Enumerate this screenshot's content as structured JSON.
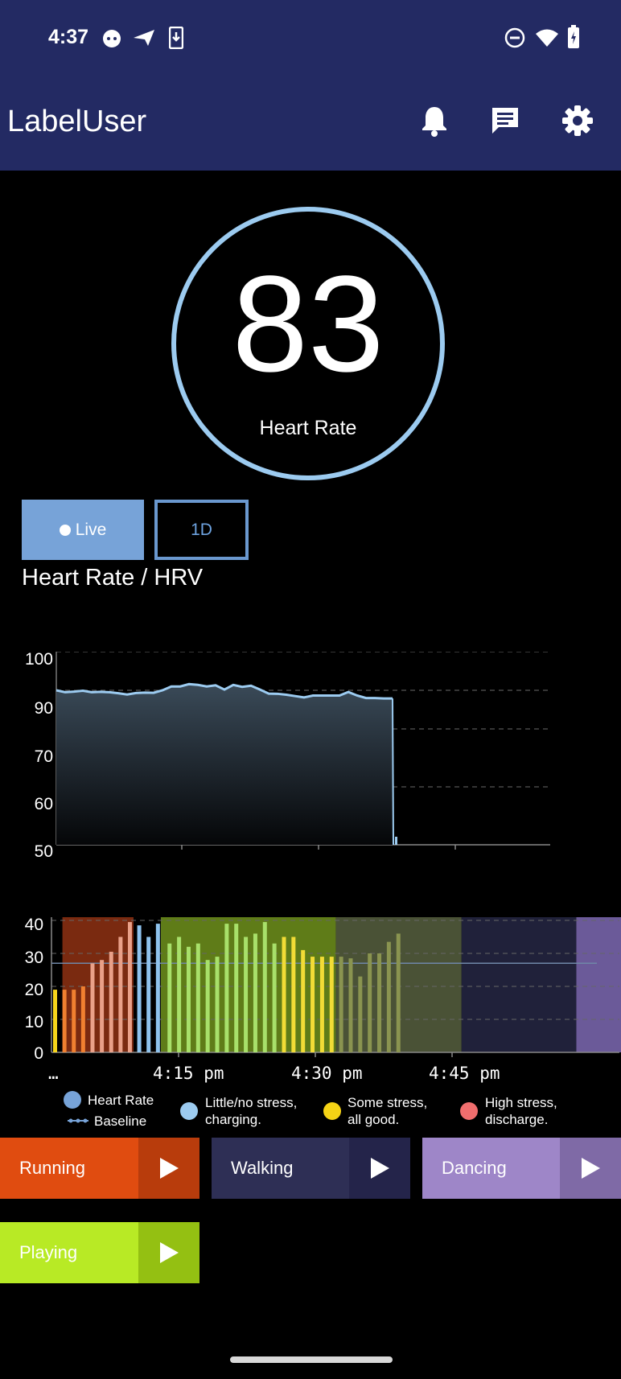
{
  "status_bar": {
    "time": "4:37",
    "left_icons": [
      "cat-face-icon",
      "send-icon",
      "download-icon"
    ],
    "right_icons": [
      "do-not-disturb-icon",
      "wifi-icon",
      "battery-charging-icon"
    ]
  },
  "app_bar": {
    "title": "LabelUser",
    "actions": [
      "bell-icon",
      "message-icon",
      "gear-icon"
    ]
  },
  "heart_rate_gauge": {
    "value": "83",
    "label": "Heart Rate",
    "ring_color": "#9ccbf0"
  },
  "tabs": {
    "live_label": "Live",
    "day_label": "1D",
    "selected": "Live"
  },
  "chart_title": "Heart Rate / HRV",
  "chart_data": [
    {
      "type": "area",
      "title": "",
      "y_ticks": [
        "100",
        "90",
        "70",
        "60",
        "50"
      ],
      "ylim": [
        50,
        100
      ],
      "grid": "dashed horizontal",
      "values": [
        90,
        89,
        89.3,
        89.8,
        89,
        89.2,
        89,
        88.5,
        87.8,
        88.6,
        88.8,
        88.7,
        90,
        91,
        91,
        91.6,
        91.4,
        91,
        91.3,
        90.2,
        91.4,
        90.9,
        91.2,
        90.2,
        88.3,
        88.2,
        87.7,
        87,
        86.3,
        87.3,
        87.3,
        87.3,
        87.3,
        89.1,
        87.3,
        86,
        86,
        85.8,
        85.8,
        50.3
      ],
      "series_color": "#9ccbf0"
    },
    {
      "type": "bar",
      "title": "",
      "y_ticks": [
        "40",
        "30",
        "20",
        "10",
        "0"
      ],
      "ylim": [
        0,
        40
      ],
      "x_ticks": [
        "…",
        "4:15 pm",
        "4:30 pm",
        "4:45 pm"
      ],
      "baseline": 27,
      "bars": [
        {
          "v": 19,
          "c": "#f7d51b"
        },
        {
          "v": 19,
          "c": "#f08030"
        },
        {
          "v": 19,
          "c": "#f08030"
        },
        {
          "v": 20,
          "c": "#f08030"
        },
        {
          "v": 27,
          "c": "#e9a088"
        },
        {
          "v": 28,
          "c": "#e9a088"
        },
        {
          "v": 30.5,
          "c": "#e9a088"
        },
        {
          "v": 35,
          "c": "#e9a088"
        },
        {
          "v": 39.5,
          "c": "#e9a088"
        },
        {
          "v": 38.5,
          "c": "#8fc3ee"
        },
        {
          "v": 35,
          "c": "#8fc3ee"
        },
        {
          "v": 39,
          "c": "#8fc3ee"
        },
        {
          "v": 33,
          "c": "#a8e06a"
        },
        {
          "v": 35,
          "c": "#a8e06a"
        },
        {
          "v": 32,
          "c": "#a8e06a"
        },
        {
          "v": 33,
          "c": "#a8e06a"
        },
        {
          "v": 28,
          "c": "#a8e06a"
        },
        {
          "v": 29,
          "c": "#a8e06a"
        },
        {
          "v": 39,
          "c": "#a8e06a"
        },
        {
          "v": 39,
          "c": "#a8e06a"
        },
        {
          "v": 35,
          "c": "#a8e06a"
        },
        {
          "v": 36,
          "c": "#a8e06a"
        },
        {
          "v": 39.5,
          "c": "#a8e06a"
        },
        {
          "v": 33,
          "c": "#a8e06a"
        },
        {
          "v": 35,
          "c": "#f2dc36"
        },
        {
          "v": 35,
          "c": "#f2dc36"
        },
        {
          "v": 31,
          "c": "#f2dc36"
        },
        {
          "v": 29,
          "c": "#f2dc36"
        },
        {
          "v": 29,
          "c": "#f2dc36"
        },
        {
          "v": 29,
          "c": "#f2dc36"
        },
        {
          "v": 29,
          "c": "#8a9450"
        },
        {
          "v": 28.5,
          "c": "#8a9450"
        },
        {
          "v": 23,
          "c": "#8a9450"
        },
        {
          "v": 30,
          "c": "#8a9450"
        },
        {
          "v": 30,
          "c": "#8a9450"
        },
        {
          "v": 33.5,
          "c": "#8a9450"
        },
        {
          "v": 36,
          "c": "#8a9450"
        }
      ],
      "activity_bands": [
        {
          "from": 0.02,
          "to": 0.15,
          "color": "#7a2a10"
        },
        {
          "from": 0.2,
          "to": 0.52,
          "color": "#5f7c18"
        },
        {
          "from": 0.52,
          "to": 0.75,
          "color": "#4a5236"
        },
        {
          "from": 0.75,
          "to": 0.96,
          "color": "#20213a"
        },
        {
          "from": 0.96,
          "to": 1.05,
          "color": "#6b5a99"
        }
      ]
    }
  ],
  "legend": {
    "heart_rate": "Heart Rate",
    "baseline": "Baseline",
    "little_stress": "Little/no stress,\ncharging.",
    "some_stress": "Some stress,\nall good.",
    "high_stress": "High stress,\ndischarge.",
    "colors": {
      "heart_rate": "#77a3d8",
      "little": "#9ccbf0",
      "some": "#f5d315",
      "high": "#f06e6e"
    }
  },
  "activities": [
    {
      "label": "Running",
      "color": "#e04c10",
      "play_color": "#b83c0c"
    },
    {
      "label": "Walking",
      "color": "#2e2f55",
      "play_color": "#24244a"
    },
    {
      "label": "Dancing",
      "color": "#9e86c8",
      "play_color": "#7f6aa6"
    },
    {
      "label": "Playing",
      "color": "#b8ea25",
      "play_color": "#94c012"
    }
  ]
}
